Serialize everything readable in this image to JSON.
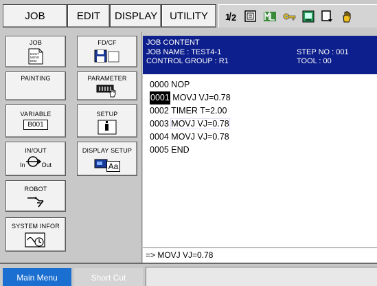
{
  "menu": {
    "job": "JOB",
    "edit": "EDIT",
    "display": "DISPLAY",
    "utility": "UTILITY"
  },
  "toolbar_icons": [
    "robot-group-icon",
    "status-display-icon",
    "manual-speed-icon",
    "security-key-icon",
    "screen-icon",
    "next-page-icon",
    "hand-icon"
  ],
  "left_panel": {
    "job": {
      "label": "JOB",
      "icon_text": [
        "DOUT",
        "MOVE",
        "END"
      ]
    },
    "fdcf": {
      "label": "FD/CF"
    },
    "painting": {
      "label": "PAINTING"
    },
    "parameter": {
      "label": "PARAMETER"
    },
    "variable": {
      "label": "VARIABLE",
      "value": "B001"
    },
    "setup": {
      "label": "SETUP"
    },
    "inout": {
      "label": "IN/OUT",
      "in": "In",
      "out": "Out"
    },
    "display_setup": {
      "label": "DISPLAY SETUP",
      "icon_text": "Aa"
    },
    "robot": {
      "label": "ROBOT"
    },
    "system_info": {
      "label": "SYSTEM INFOR"
    }
  },
  "job_content": {
    "title": "JOB CONTENT",
    "job_name": "JOB NAME : TEST4-1",
    "step_no": "STEP NO : 001",
    "control_group": "CONTROL GROUP : R1",
    "tool": "TOOL : 00",
    "lines": [
      {
        "num": "0000",
        "text": "NOP"
      },
      {
        "num": "0001",
        "text": "MOVJ VJ=0.78"
      },
      {
        "num": "0002",
        "text": "TIMER T=2.00"
      },
      {
        "num": "0003",
        "text": "MOVJ VJ=0.78"
      },
      {
        "num": "0004",
        "text": "MOVJ VJ=0.78"
      },
      {
        "num": "0005",
        "text": "END"
      }
    ],
    "edit_line": "=> MOVJ  VJ=0.78"
  },
  "bottom": {
    "main_menu": "Main Menu",
    "short_cut": "Short Cut"
  },
  "colors": {
    "header_bg": "#0d1f8c",
    "main_menu_bg": "#1b6fd0",
    "short_cut_bg": "#d4d4d4",
    "panel_bg": "#c8c8c8"
  }
}
